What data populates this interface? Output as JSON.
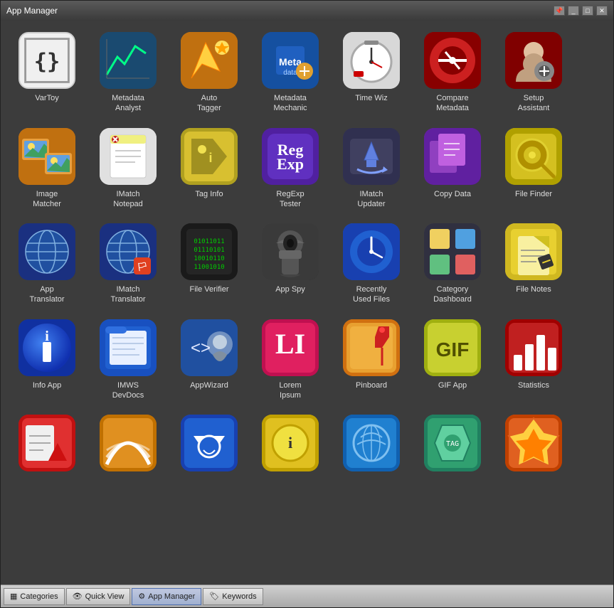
{
  "window": {
    "title": "App Manager",
    "buttons": [
      "pin",
      "minimize",
      "maximize",
      "close"
    ]
  },
  "apps": [
    {
      "id": "vartoy",
      "label": "VarToy",
      "row": 1
    },
    {
      "id": "metadata-analyst",
      "label": "Metadata\nAnalyst",
      "row": 1
    },
    {
      "id": "auto-tagger",
      "label": "Auto\nTagger",
      "row": 1
    },
    {
      "id": "metadata-mechanic",
      "label": "Metadata\nMechanic",
      "row": 1
    },
    {
      "id": "time-wiz",
      "label": "Time Wiz",
      "row": 1
    },
    {
      "id": "compare-metadata",
      "label": "Compare\nMetadata",
      "row": 1
    },
    {
      "id": "setup-assistant",
      "label": "Setup\nAssistant",
      "row": 1
    },
    {
      "id": "image-matcher",
      "label": "Image\nMatcher",
      "row": 2
    },
    {
      "id": "imatch-notepad",
      "label": "IMatch\nNotepad",
      "row": 2
    },
    {
      "id": "tag-info",
      "label": "Tag Info",
      "row": 2
    },
    {
      "id": "regexp-tester",
      "label": "RegExp\nTester",
      "row": 2
    },
    {
      "id": "imatch-updater",
      "label": "IMatch\nUpdater",
      "row": 2
    },
    {
      "id": "copy-data",
      "label": "Copy Data",
      "row": 2
    },
    {
      "id": "file-finder",
      "label": "File Finder",
      "row": 2
    },
    {
      "id": "app-translator",
      "label": "App\nTranslator",
      "row": 3
    },
    {
      "id": "imatch-translator",
      "label": "IMatch\nTranslator",
      "row": 3
    },
    {
      "id": "file-verifier",
      "label": "File Verifier",
      "row": 3
    },
    {
      "id": "app-spy",
      "label": "App Spy",
      "row": 3
    },
    {
      "id": "recently-used",
      "label": "Recently\nUsed Files",
      "row": 3
    },
    {
      "id": "category-dashboard",
      "label": "Category\nDashboard",
      "row": 3
    },
    {
      "id": "file-notes",
      "label": "File Notes",
      "row": 3
    },
    {
      "id": "info-app",
      "label": "Info App",
      "row": 4
    },
    {
      "id": "imws-devdocs",
      "label": "IMWS\nDevDocs",
      "row": 4
    },
    {
      "id": "appwizard",
      "label": "AppWizard",
      "row": 4
    },
    {
      "id": "lorem-ipsum",
      "label": "Lorem\nIpsum",
      "row": 4
    },
    {
      "id": "pinboard",
      "label": "Pinboard",
      "row": 4
    },
    {
      "id": "gif-app",
      "label": "GIF App",
      "row": 4
    },
    {
      "id": "statistics",
      "label": "Statistics",
      "row": 4
    },
    {
      "id": "row5-1",
      "label": "",
      "row": 5
    },
    {
      "id": "row5-2",
      "label": "",
      "row": 5
    },
    {
      "id": "row5-3",
      "label": "",
      "row": 5
    },
    {
      "id": "row5-4",
      "label": "",
      "row": 5
    },
    {
      "id": "row5-5",
      "label": "",
      "row": 5
    },
    {
      "id": "row5-6",
      "label": "",
      "row": 5
    },
    {
      "id": "row5-7",
      "label": "",
      "row": 5
    }
  ],
  "taskbar": {
    "items": [
      {
        "id": "categories",
        "label": "Categories",
        "icon": "grid"
      },
      {
        "id": "quick-view",
        "label": "Quick View",
        "icon": "eye"
      },
      {
        "id": "app-manager",
        "label": "App Manager",
        "icon": "apps",
        "active": true
      },
      {
        "id": "keywords",
        "label": "Keywords",
        "icon": "tag"
      }
    ]
  }
}
